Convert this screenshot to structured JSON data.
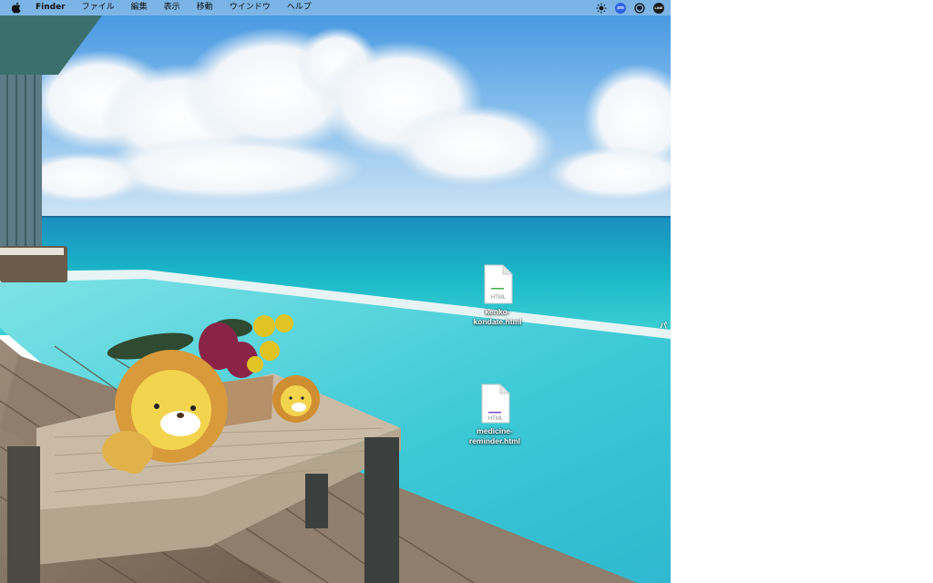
{
  "menubar": {
    "apple_icon": "apple-logo-icon",
    "app_name": "Finder",
    "items": [
      "ファイル",
      "編集",
      "表示",
      "移動",
      "ウインドウ",
      "ヘルプ"
    ],
    "status_icons": [
      "brightness-icon",
      "zoom-icon",
      "screen-time-icon",
      "line-icon"
    ],
    "zoom_badge": "zm",
    "line_badge": "LINE"
  },
  "desktop": {
    "files": [
      {
        "name": "kenko-kondate.html",
        "label": "kenko-\nkondate.html",
        "type_label": "HTML",
        "accent": "#3db34a"
      },
      {
        "name": "medicine-reminder.html",
        "label": "medicine-\nreminder.html",
        "type_label": "HTML",
        "accent": "#7a4bd6"
      }
    ],
    "edge_text": "パ"
  },
  "colors": {
    "sky": "#5aa6e6",
    "sea": "#1fb6c9",
    "pool": "#52d4dc",
    "deck": "#8a7a68"
  }
}
